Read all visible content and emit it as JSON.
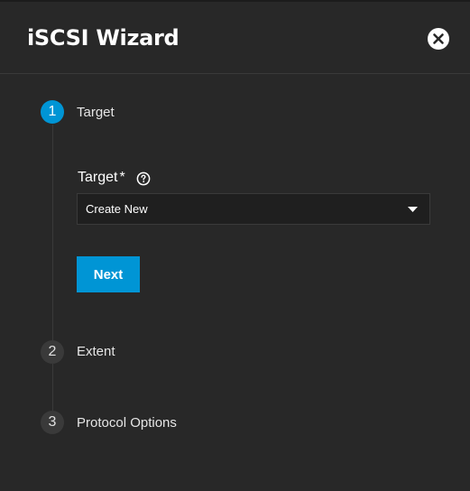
{
  "dialog": {
    "title": "iSCSI Wizard",
    "close_icon": "close-icon"
  },
  "steps": [
    {
      "number": "1",
      "label": "Target",
      "state": "active"
    },
    {
      "number": "2",
      "label": "Extent",
      "state": "inactive"
    },
    {
      "number": "3",
      "label": "Protocol Options",
      "state": "inactive"
    }
  ],
  "target_step": {
    "field_label": "Target",
    "required_marker": "*",
    "help_icon": "help-icon",
    "select_value": "Create New",
    "next_label": "Next"
  },
  "colors": {
    "background": "#282828",
    "accent": "#0095d5",
    "inactive_step": "#3a3a3a"
  }
}
